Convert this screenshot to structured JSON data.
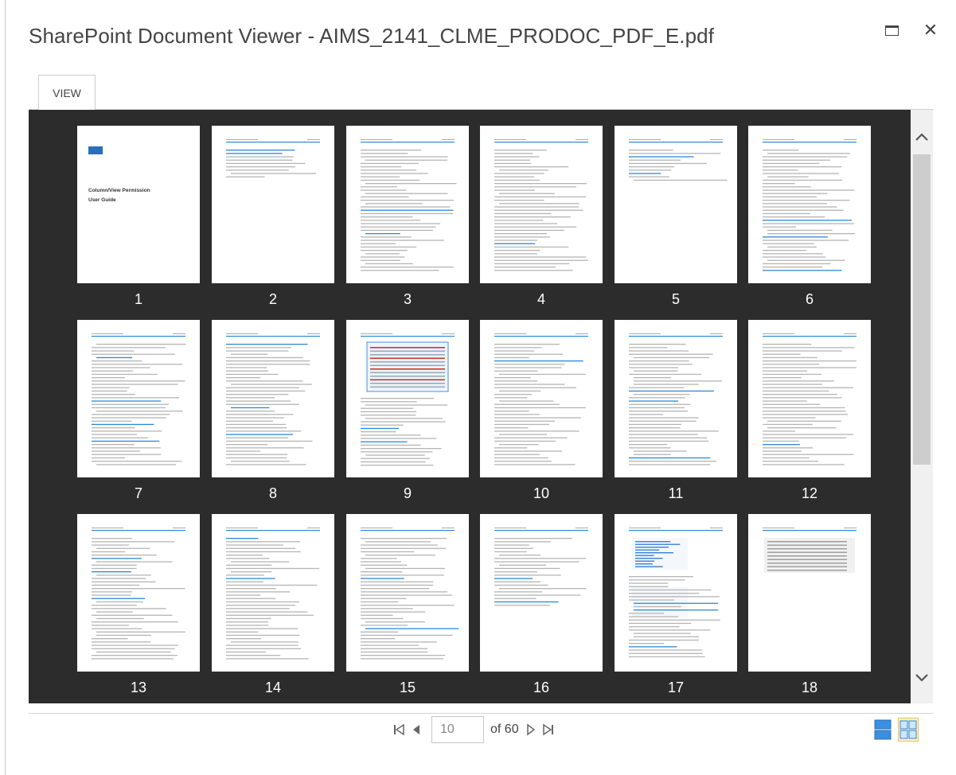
{
  "title": "SharePoint Document Viewer - AIMS_2141_CLME_PRODOC_PDF_E.pdf",
  "window": {
    "maximize_icon": "maximize-icon",
    "close_glyph": "✕"
  },
  "tabs": [
    {
      "label": "VIEW",
      "active": true
    }
  ],
  "pages": [
    {
      "number": "1",
      "cover_title": "Column/View Permission",
      "cover_subtitle": "User Guide"
    },
    {
      "number": "2"
    },
    {
      "number": "3"
    },
    {
      "number": "4"
    },
    {
      "number": "5"
    },
    {
      "number": "6"
    },
    {
      "number": "7"
    },
    {
      "number": "8"
    },
    {
      "number": "9"
    },
    {
      "number": "10"
    },
    {
      "number": "11"
    },
    {
      "number": "12"
    },
    {
      "number": "13"
    },
    {
      "number": "14"
    },
    {
      "number": "15"
    },
    {
      "number": "16"
    },
    {
      "number": "17"
    },
    {
      "number": "18"
    }
  ],
  "pager": {
    "current_page": "10",
    "of_label": "of 60",
    "first_icon": "first-page-icon",
    "prev_icon": "previous-page-icon",
    "next_icon": "next-page-icon",
    "last_icon": "last-page-icon"
  },
  "view_modes": {
    "active": "grid",
    "single_icon": "single-page-view-icon",
    "grid_icon": "grid-view-icon"
  },
  "colors": {
    "viewer_bg": "#2c2c2c",
    "accent": "#2b88d8",
    "grid_active_bg": "#fff2c0"
  }
}
